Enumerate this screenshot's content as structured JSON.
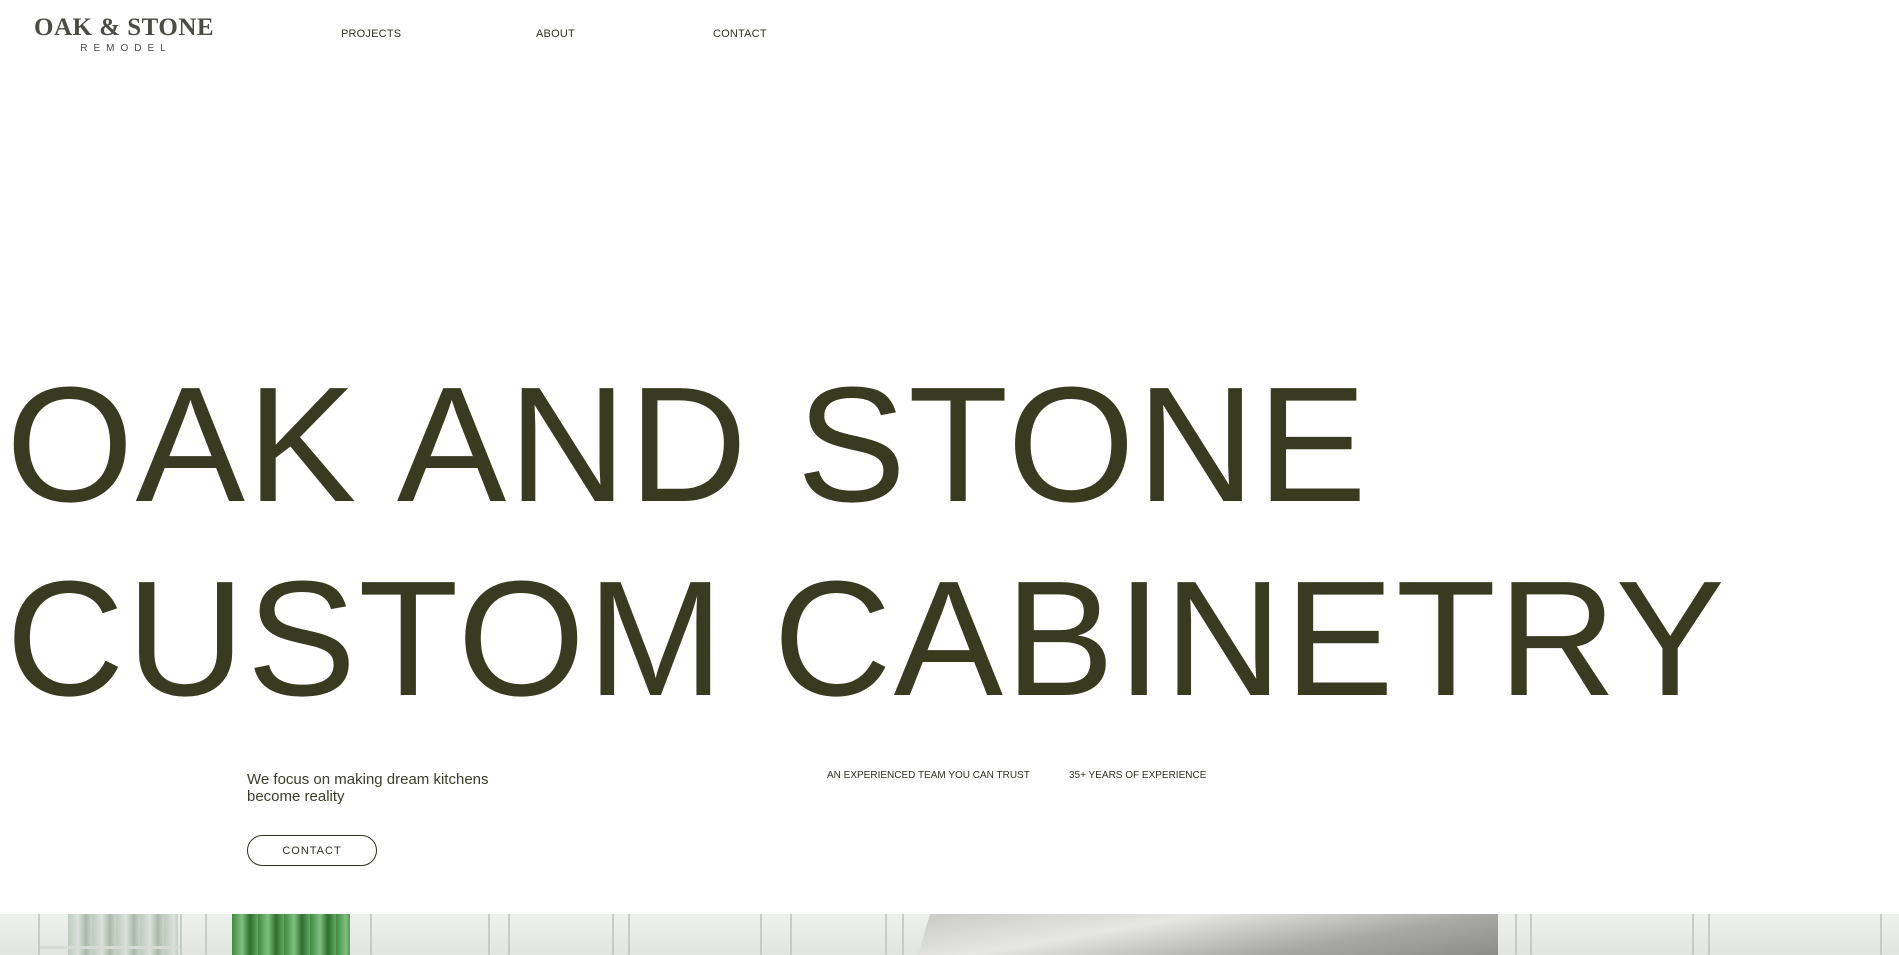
{
  "header": {
    "logo_main": "OAK & STONE",
    "logo_sub": "REMODEL",
    "nav": [
      "PROJECTS",
      "ABOUT",
      "CONTACT"
    ]
  },
  "hero": {
    "line1": "OAK AND STONE",
    "line2": "CUSTOM CABINETRY"
  },
  "intro": {
    "tagline": "We focus on making dream kitchens become reality",
    "contact_button": "CONTACT"
  },
  "features": [
    "AN EXPERIENCED TEAM YOU CAN TRUST",
    "35+ YEARS OF EXPERIENCE"
  ],
  "colors": {
    "text_primary": "#393b21",
    "logo": "#4a4c45",
    "background": "#ffffff"
  }
}
